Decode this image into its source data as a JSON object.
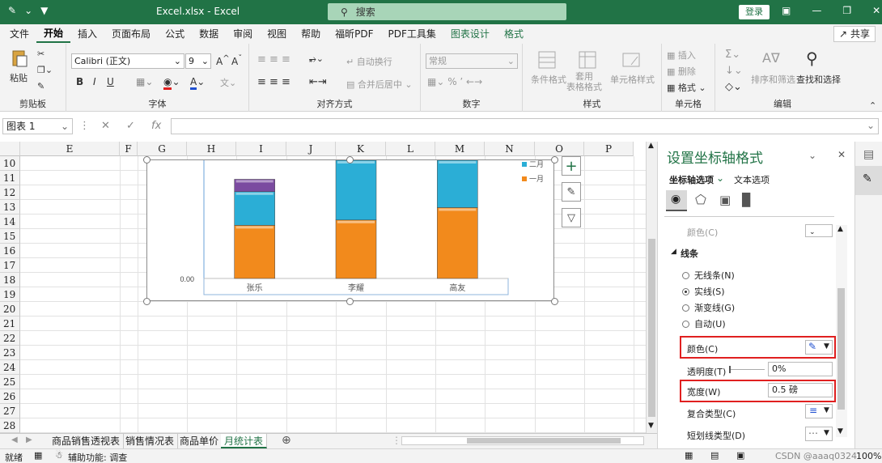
{
  "titlebar": {
    "title": "Excel.xlsx  -  Excel",
    "search_placeholder": "搜索",
    "login_label": "登录"
  },
  "ribbon_tabs": [
    "文件",
    "开始",
    "插入",
    "页面布局",
    "公式",
    "数据",
    "审阅",
    "视图",
    "帮助",
    "福昕PDF",
    "PDF工具集",
    "图表设计",
    "格式"
  ],
  "share_label": "共享",
  "ribbon": {
    "clipboard": {
      "label": "剪贴板",
      "paste": "粘贴"
    },
    "font": {
      "label": "字体",
      "font_name": "Calibri (正文)",
      "font_size": "9"
    },
    "alignment": {
      "label": "对齐方式",
      "wrap": "自动换行",
      "merge": "合并后居中"
    },
    "number": {
      "label": "数字",
      "format": "常规"
    },
    "styles": {
      "label": "样式",
      "cond": "条件格式",
      "table": "套用\n表格格式",
      "cell": "单元格样式"
    },
    "cells": {
      "label": "单元格",
      "insert": "插入",
      "delete": "删除",
      "format": "格式"
    },
    "editing": {
      "label": "编辑",
      "sort": "排序和筛选",
      "find": "查找和选择"
    }
  },
  "formula_bar": {
    "name_box": "图表 1",
    "fx": "fx"
  },
  "columns": [
    "E",
    "F",
    "G",
    "H",
    "I",
    "J",
    "K",
    "L",
    "M",
    "N",
    "O",
    "P"
  ],
  "rows": [
    "10",
    "11",
    "12",
    "13",
    "14",
    "15",
    "16",
    "17",
    "18",
    "19",
    "20",
    "21",
    "22",
    "23",
    "24",
    "25",
    "26",
    "27",
    "28"
  ],
  "chart_data": {
    "type": "bar",
    "stacked": true,
    "categories": [
      "张乐",
      "李耀",
      "高友"
    ],
    "series": [
      {
        "name": "一月",
        "color": "#f28a1c",
        "values": [
          30,
          33,
          40
        ]
      },
      {
        "name": "二月",
        "color": "#2baed6",
        "values": [
          19,
          52,
          48
        ]
      },
      {
        "name": "",
        "color": "#7b4aa0",
        "values": [
          7,
          3,
          0
        ]
      }
    ],
    "ylim": [
      0,
      85
    ],
    "y_tick_label": "0.00",
    "legend": {
      "position": "top-right",
      "entries": [
        "二月",
        "一月"
      ]
    }
  },
  "sheet_tabs": [
    "商品销售透视表",
    "销售情况表",
    "商品单价",
    "月统计表"
  ],
  "active_sheet": "月统计表",
  "status": {
    "ready": "就绪",
    "accessibility": "辅助功能: 调查",
    "zoom": "100%",
    "watermark": "CSDN @aaaq0324"
  },
  "pane": {
    "title": "设置坐标轴格式",
    "tab_axis_options": "坐标轴选项",
    "tab_text_options": "文本选项",
    "top_cut_label": "颜色(C)",
    "section_line": "线条",
    "opt_none": "无线条(N)",
    "opt_solid": "实线(S)",
    "opt_gradient": "渐变线(G)",
    "opt_auto": "自动(U)",
    "color_label": "颜色(C)",
    "transparency_label": "透明度(T)",
    "transparency_value": "0%",
    "width_label": "宽度(W)",
    "width_value": "0.5 磅",
    "compound_label": "复合类型(C)",
    "dash_label": "短划线类型(D)",
    "accent": "#e02020"
  }
}
